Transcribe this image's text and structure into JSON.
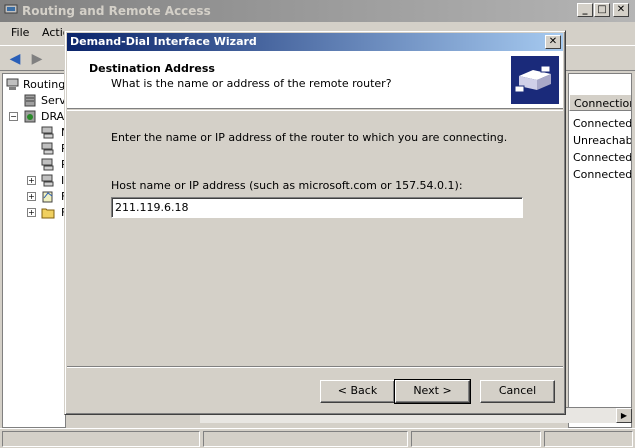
{
  "main_window": {
    "title": "Routing and Remote Access",
    "caption_buttons": {
      "minimize": "_",
      "maximize": "□",
      "close": "✕"
    },
    "menu": [
      "File",
      "Actio"
    ],
    "toolbar": {
      "back_icon": "back-arrow-icon",
      "forward_icon": "forward-arrow-icon"
    },
    "tree": {
      "items": [
        {
          "label": "Routing"
        },
        {
          "label": "Serv"
        },
        {
          "label": "DRA"
        },
        {
          "label": "N"
        },
        {
          "label": "P"
        },
        {
          "label": "P"
        },
        {
          "label": "I"
        },
        {
          "label": "F"
        },
        {
          "label": "F"
        }
      ]
    },
    "list": {
      "column_header": "Connection",
      "rows": [
        "Connected",
        "Unreachabl",
        "Connected",
        "Connected"
      ]
    }
  },
  "wizard": {
    "title": "Demand-Dial Interface Wizard",
    "close_glyph": "✕",
    "heading": "Destination Address",
    "subheading": "What is the name or address of the remote router?",
    "instruction": "Enter the name or IP address of the router to which you are connecting.",
    "host_label": "Host name or IP address (such as microsoft.com or 157.54.0.1):",
    "host_value": "211.119.6.18",
    "back_label": "< Back",
    "next_label": "Next >",
    "cancel_label": "Cancel"
  },
  "colors": {
    "active_title_start": "#0a246a",
    "active_title_end": "#a6caf0",
    "inactive_title_start": "#808080",
    "face": "#d4d0c8"
  }
}
